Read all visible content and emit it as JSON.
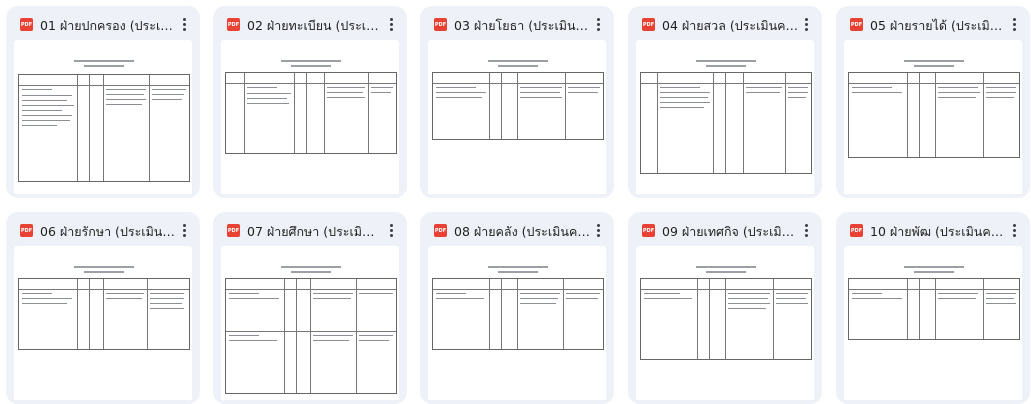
{
  "files": [
    {
      "title": "01 ฝ่ายปกครอง (ประเมินค..."
    },
    {
      "title": "02 ฝ่ายทะเบียน (ประเมินค..."
    },
    {
      "title": "03 ฝ่ายโยธา (ประเมินควา..."
    },
    {
      "title": "04 ฝ่ายสวล (ประเมินความ..."
    },
    {
      "title": "05 ฝ่ายรายได้ (ประเมินค..."
    },
    {
      "title": "06 ฝ่ายรักษา (ประเมินควา..."
    },
    {
      "title": "07 ฝ่ายศึกษา (ประเมินควา..."
    },
    {
      "title": "08 ฝ่ายคลัง (ประเมินความ..."
    },
    {
      "title": "09 ฝ่ายเทศกิจ (ประเมินค..."
    },
    {
      "title": "10 ฝ่ายพัฒ (ประเมินความเ..."
    }
  ],
  "file_type_badge": "PDF",
  "icons": {
    "file": "pdf-file-icon",
    "menu": "more-vert-icon"
  },
  "colors": {
    "card_bg": "#eef1f7",
    "pdf_icon": "#e94235"
  }
}
